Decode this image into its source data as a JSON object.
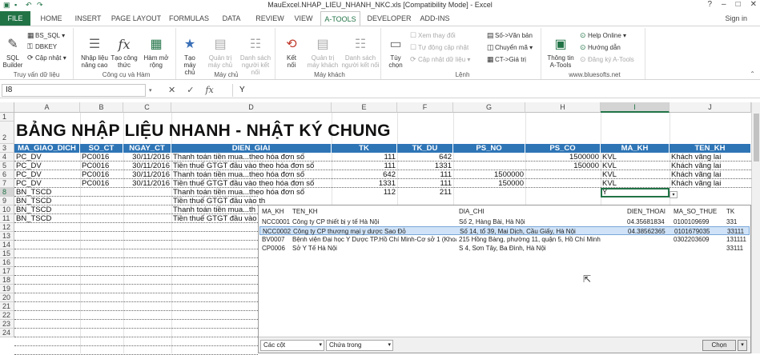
{
  "window": {
    "title": "MauExcel.NHAP_LIEU_NHANH_NKC.xls  [Compatibility Mode] - Excel",
    "signin": "Sign in"
  },
  "tabs": [
    "FILE",
    "HOME",
    "INSERT",
    "PAGE LAYOUT",
    "FORMULAS",
    "DATA",
    "REVIEW",
    "VIEW",
    "A-TOOLS",
    "DEVELOPER",
    "ADD-INS"
  ],
  "ribbon": {
    "g1": {
      "label": "Truy vấn dữ liệu",
      "sql": "SQL\nBuilder",
      "bs_sql": "BS_SQL",
      "dbkey": "DBKEY",
      "cap_nhat": "Cập nhật"
    },
    "g2": {
      "label": "Công cụ và Hàm",
      "b1": "Nhập liệu\nnâng cao",
      "b2": "Tạo công\nthức",
      "b3": "Hàm mở\nrộng"
    },
    "g3": {
      "label": "Máy chủ",
      "b1": "Tạo\nmáy chủ",
      "b2": "Quản trị\nmáy chủ",
      "b3": "Danh sách\nngười kết nối"
    },
    "g4": {
      "label": "Máy khách",
      "b1": "Kết\nnối",
      "b2": "Quản trị\nmáy khách",
      "b3": "Danh sách\nngười kết nối"
    },
    "g5": {
      "label": "Lệnh",
      "b1": "Tùy\nchọn",
      "s1": "Xem thay đổi",
      "s2": "Tự động cập nhật",
      "s3": "Cập nhật dữ liệu",
      "s4": "Số->Văn bản",
      "s5": "Chuyển mã",
      "s6": "CT->Giá trị"
    },
    "g6": {
      "label": "www.bluesofts.net",
      "b1": "Thông tin\nA-Tools",
      "s1": "Help Online",
      "s2": "Hướng dẫn",
      "s3": "Đăng ký A-Tools"
    }
  },
  "formula_bar": {
    "name_box": "I8",
    "value": "Y"
  },
  "sheet": {
    "columns": [
      "A",
      "B",
      "C",
      "D",
      "E",
      "F",
      "G",
      "H",
      "I",
      "J"
    ],
    "rows": [
      "1",
      "2",
      "3",
      "4",
      "5",
      "6",
      "7",
      "8",
      "9",
      "10",
      "11",
      "12",
      "13",
      "14",
      "15",
      "16",
      "17",
      "18",
      "19",
      "20",
      "21",
      "22",
      "23",
      "24"
    ],
    "title": "BẢNG NHẬP LIỆU NHANH - NHẬT KÝ CHUNG",
    "headers": [
      "MA_GIAO_DICH",
      "SO_CT",
      "NGAY_CT",
      "DIEN_GIAI",
      "TK",
      "TK_DU",
      "PS_NO",
      "PS_CO",
      "MA_KH",
      "TEN_KH"
    ],
    "data": [
      [
        "PC_DV",
        "PC0016",
        "30/11/2016",
        "Thanh toán tiền mua...theo hóa đơn số",
        "111",
        "642",
        "",
        "1500000",
        "KVL",
        "Khách vãng lai"
      ],
      [
        "PC_DV",
        "PC0016",
        "30/11/2016",
        "Tiền thuế GTGT đầu vào theo hóa đơn số",
        "111",
        "1331",
        "",
        "150000",
        "KVL",
        "Khách vãng lai"
      ],
      [
        "PC_DV",
        "PC0016",
        "30/11/2016",
        "Thanh toán tiền mua...theo hóa đơn số",
        "642",
        "111",
        "1500000",
        "",
        "KVL",
        "Khách vãng lai"
      ],
      [
        "PC_DV",
        "PC0016",
        "30/11/2016",
        "Tiền thuế GTGT đầu vào theo hóa đơn số",
        "1331",
        "111",
        "150000",
        "",
        "KVL",
        "Khách vãng lai"
      ],
      [
        "BN_TSCD",
        "",
        "",
        "Thanh toán tiền mua...theo hóa đơn số",
        "112",
        "211",
        "",
        "",
        "Y",
        ""
      ],
      [
        "BN_TSCD",
        "",
        "",
        "Tiền thuế GTGT đầu vào th",
        "",
        "",
        "",
        "",
        "",
        ""
      ],
      [
        "BN_TSCD",
        "",
        "",
        "Thanh toán tiền mua...th",
        "",
        "",
        "",
        "",
        "",
        ""
      ],
      [
        "BN_TSCD",
        "",
        "",
        "Tiền thuế GTGT đầu vào th",
        "",
        "",
        "",
        "",
        "",
        ""
      ]
    ]
  },
  "dropdown": {
    "headers": [
      "MA_KH",
      "TEN_KH",
      "DIA_CHI",
      "DIEN_THOAI",
      "MA_SO_THUE",
      "TK"
    ],
    "rows": [
      [
        "NCC0001",
        "Công ty CP thiết bị y tế Hà Nội",
        "Số 2, Hàng Bài, Hà Nội",
        "04.35681834",
        "0100109699",
        "331"
      ],
      [
        "NCC0002",
        "Công ty CP thương mại y dược Sao Đỏ",
        "Số 14, tổ 39, Mai Dịch, Cầu Giấy, Hà Nội",
        "04.38562365",
        "0101679035",
        "33111"
      ],
      [
        "BV0007",
        "Bệnh viện Đại học Y Dược TP.Hồ Chí Minh-Cơ sở 1 (Khoa ...",
        "215 Hồng Bàng, phường 11, quận 5, Hồ Chí Minh",
        "",
        "0302203609",
        "131111"
      ],
      [
        "CP0006",
        "Sở Y Tế Hà Nội",
        "S 4, Sơn Tây, Ba Đình, Hà Nội",
        "",
        "",
        "33111"
      ]
    ],
    "select1": "Các cột",
    "select2": "Chứa trong",
    "ok": "Chọn"
  }
}
